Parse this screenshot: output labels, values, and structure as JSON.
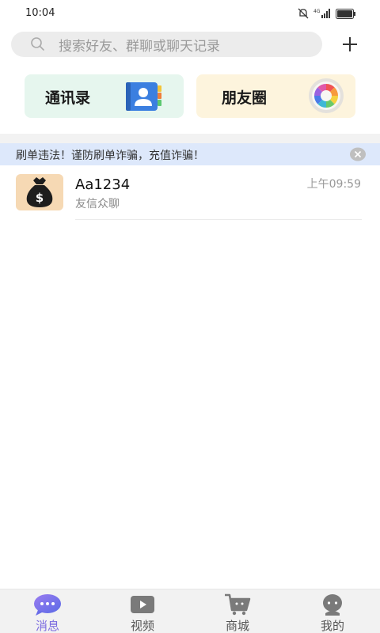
{
  "status_bar": {
    "time": "10:04",
    "network_label": "4G"
  },
  "search": {
    "placeholder": "搜索好友、群聊或聊天记录"
  },
  "quick_cards": {
    "contacts_label": "通讯录",
    "moments_label": "朋友圈"
  },
  "notice": {
    "text": "刷单违法！谨防刷单诈骗，充值诈骗！"
  },
  "chats": [
    {
      "name": "Aa1234",
      "preview": "友信众聊",
      "time": "上午09:59"
    }
  ],
  "bottom_nav": [
    {
      "label": "消息",
      "icon": "message-icon",
      "active": true
    },
    {
      "label": "视频",
      "icon": "video-icon",
      "active": false
    },
    {
      "label": "商城",
      "icon": "shop-cart-icon",
      "active": false
    },
    {
      "label": "我的",
      "icon": "profile-icon",
      "active": false
    }
  ],
  "colors": {
    "accent": "#7b6be0",
    "contacts_card_bg": "#e6f6ee",
    "moments_card_bg": "#fdf4dd",
    "notice_bg": "#dde8fb"
  }
}
